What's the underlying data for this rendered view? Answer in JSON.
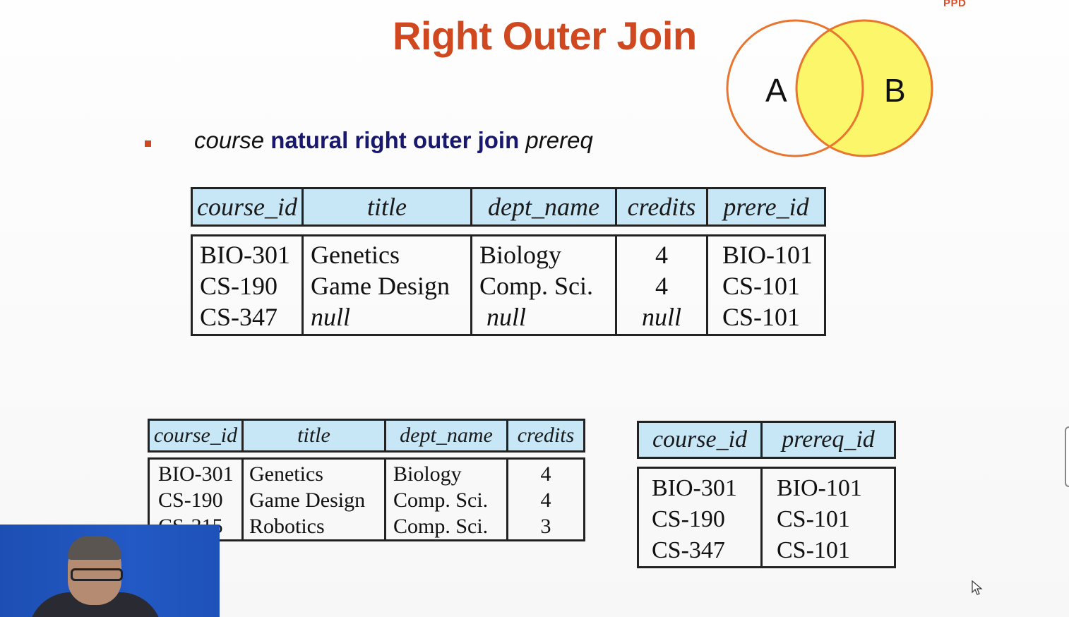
{
  "logo": "PPD",
  "title": "Right Outer Join",
  "venn": {
    "left_label": "A",
    "right_label": "B",
    "outline_color": "#e8762e",
    "fill_color": "#fbf66a"
  },
  "bullet": {
    "relation1": "course",
    "operator": "natural right outer join",
    "relation2": "prereq"
  },
  "result_table": {
    "headers": [
      "course_id",
      "title",
      "dept_name",
      "credits",
      "prere_id"
    ],
    "columns": [
      [
        "BIO-301",
        "CS-190",
        "CS-347"
      ],
      [
        "Genetics",
        "Game Design",
        "null"
      ],
      [
        "Biology",
        "Comp. Sci.",
        "null"
      ],
      [
        "4",
        "4",
        "null"
      ],
      [
        "BIO-101",
        "CS-101",
        "CS-101"
      ]
    ]
  },
  "course_table": {
    "headers": [
      "course_id",
      "title",
      "dept_name",
      "credits"
    ],
    "columns": [
      [
        "BIO-301",
        "CS-190",
        "CS-315"
      ],
      [
        "Genetics",
        "Game Design",
        "Robotics"
      ],
      [
        "Biology",
        "Comp. Sci.",
        "Comp. Sci."
      ],
      [
        "4",
        "4",
        "3"
      ]
    ]
  },
  "prereq_table": {
    "headers": [
      "course_id",
      "prereq_id"
    ],
    "columns": [
      [
        "BIO-301",
        "CS-190",
        "CS-347"
      ],
      [
        "BIO-101",
        "CS-101",
        "CS-101"
      ]
    ]
  },
  "colors": {
    "title": "#d0481f",
    "keyword": "#18186e",
    "header_fill": "#c7e6f6"
  },
  "video_overlay": "presenter-webcam"
}
